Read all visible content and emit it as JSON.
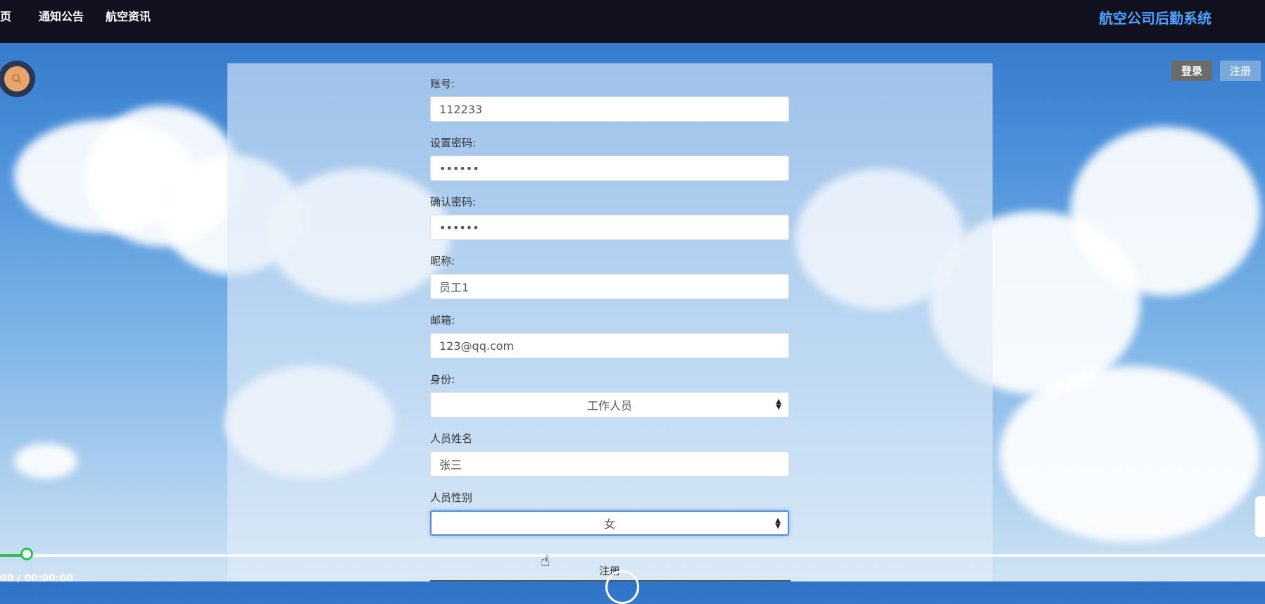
{
  "nav": {
    "items": [
      {
        "label": "页"
      },
      {
        "label": "通知公告"
      },
      {
        "label": "航空资讯"
      }
    ],
    "brand": "航空公司后勤系统"
  },
  "auth": {
    "login_label": "登录",
    "register_label": "注册"
  },
  "form": {
    "account": {
      "label": "账号:",
      "value": "112233"
    },
    "password": {
      "label": "设置密码:",
      "value": "••••••"
    },
    "confirm_password": {
      "label": "确认密码:",
      "value": "••••••"
    },
    "nickname": {
      "label": "昵称:",
      "value": "员工1"
    },
    "email": {
      "label": "邮箱:",
      "value": "123@qq.com"
    },
    "role": {
      "label": "身份:",
      "value": "工作人员"
    },
    "staff_name": {
      "label": "人员姓名",
      "value": "张三"
    },
    "staff_gender": {
      "label": "人员性别",
      "value": "女"
    },
    "submit_label": "注册"
  },
  "video": {
    "time": "00 / 00:00:00",
    "progress": 0.02
  },
  "icons": {
    "search": "search-icon",
    "select_arrow": "sort-arrows-icon"
  }
}
